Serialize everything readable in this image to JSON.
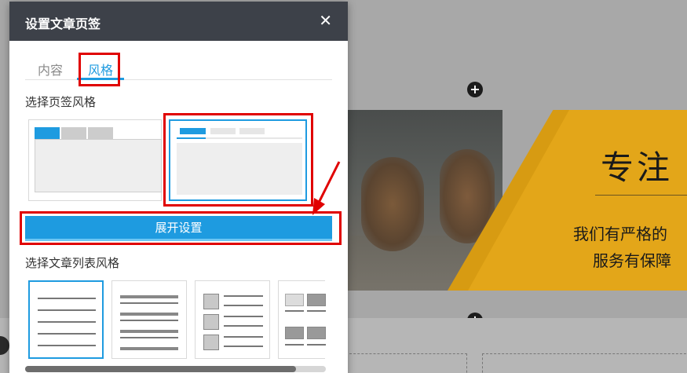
{
  "background": {
    "banner_title": "专注",
    "banner_line1": "我们有严格的",
    "banner_line2": "服务有保障",
    "plus_glyph": "+"
  },
  "dialog": {
    "title": "设置文章页签",
    "close_glyph": "✕",
    "tabs": [
      {
        "label": "内容",
        "active": false
      },
      {
        "label": "风格",
        "active": true
      }
    ],
    "tab_style_label": "选择页签风格",
    "expand_button_label": "展开设置",
    "list_style_label": "选择文章列表风格"
  },
  "colors": {
    "accent": "#1e9be0",
    "header_bg": "#3d4149",
    "highlight_red": "#e00000",
    "banner_yellow": "#e3a619"
  }
}
